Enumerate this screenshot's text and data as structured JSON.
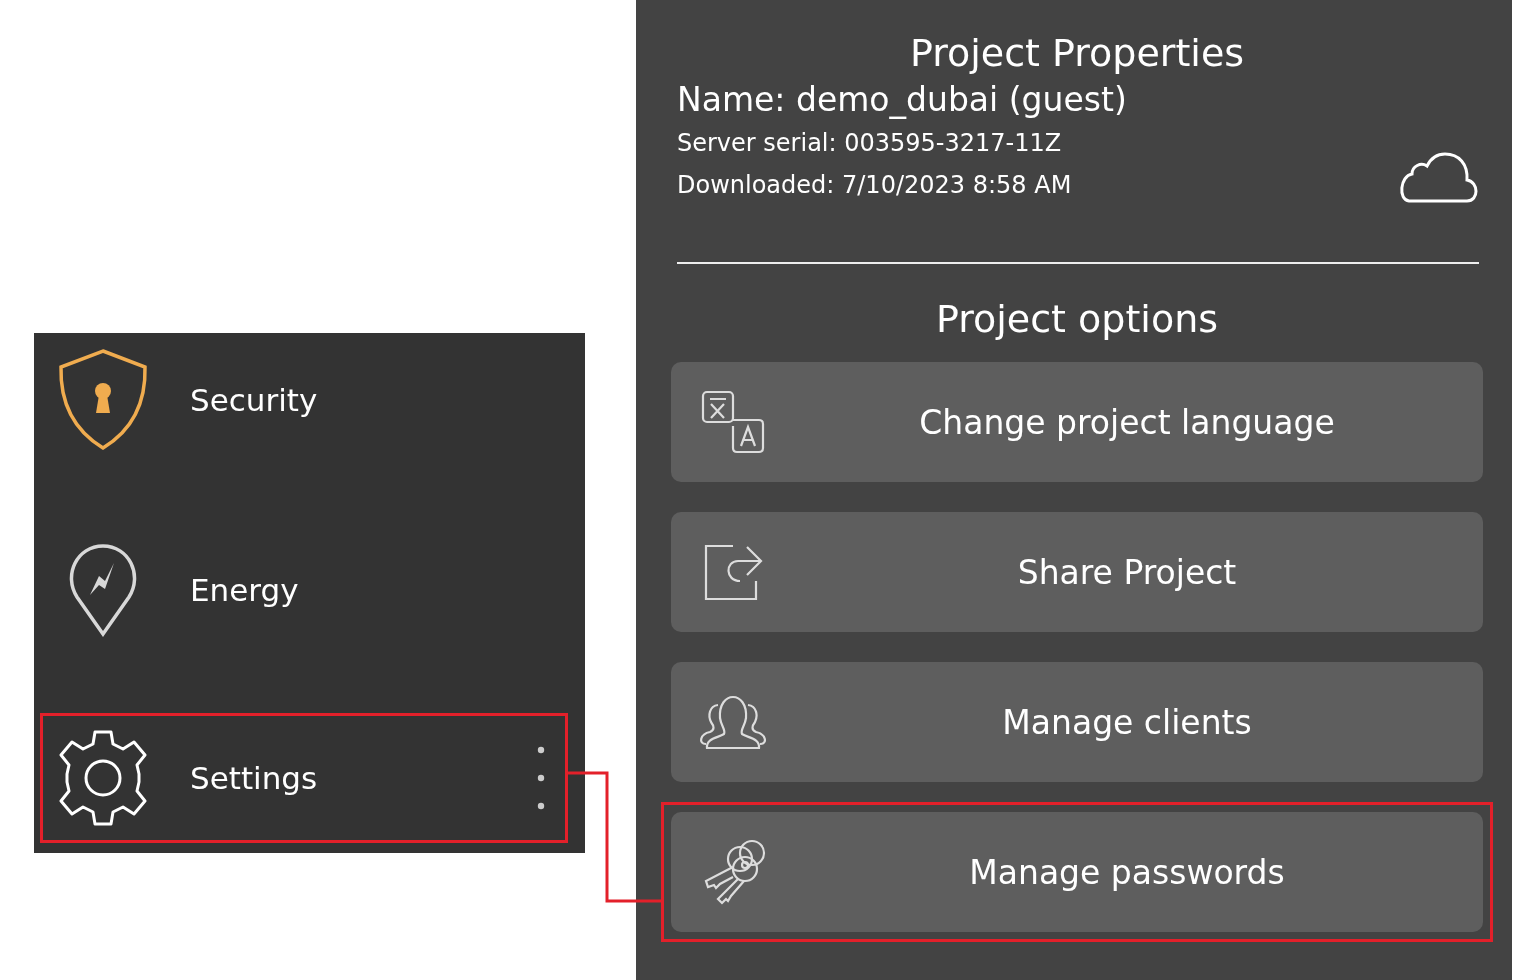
{
  "menu": {
    "items": [
      {
        "label": "Security",
        "highlighted": false
      },
      {
        "label": "Energy",
        "highlighted": false
      },
      {
        "label": "Settings",
        "highlighted": true,
        "more_menu": true
      }
    ]
  },
  "project_properties": {
    "title": "Project Properties",
    "name": "Name: demo_dubai (guest)",
    "serial": "Server serial: 003595-3217-11Z",
    "downloaded": "Downloaded: 7/10/2023 8:58 AM"
  },
  "project_options": {
    "title": "Project options",
    "buttons": [
      {
        "label": "Change project language",
        "highlighted": false
      },
      {
        "label": "Share Project",
        "highlighted": false
      },
      {
        "label": "Manage clients",
        "highlighted": false
      },
      {
        "label": "Manage passwords",
        "highlighted": true
      }
    ]
  },
  "callout_connector": true
}
